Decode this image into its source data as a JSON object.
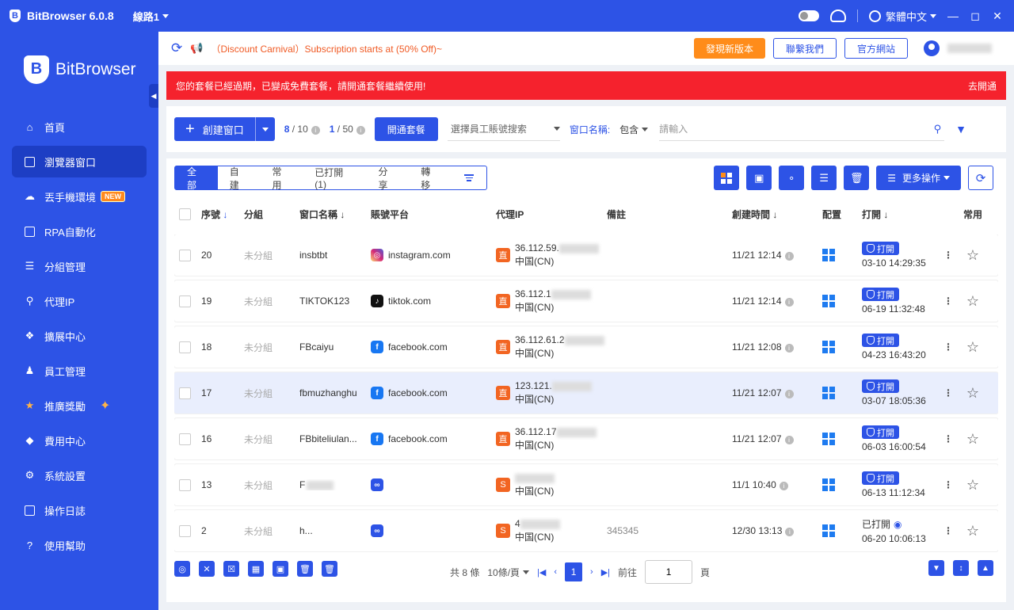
{
  "app": {
    "title": "BitBrowser 6.0.8",
    "line": "線路1",
    "language": "繁體中文"
  },
  "sidebar": {
    "brand": "BitBrowser",
    "items": [
      {
        "label": "首頁",
        "icon": "home-icon"
      },
      {
        "label": "瀏覽器窗口",
        "icon": "grid-icon",
        "active": true
      },
      {
        "label": "丟手機環境",
        "icon": "cloud-phone-icon",
        "badge": "NEW"
      },
      {
        "label": "RPA自動化",
        "icon": "rpa-icon"
      },
      {
        "label": "分組管理",
        "icon": "layers-icon"
      },
      {
        "label": "代理IP",
        "icon": "location-icon"
      },
      {
        "label": "擴展中心",
        "icon": "extension-icon"
      },
      {
        "label": "員工管理",
        "icon": "users-icon"
      },
      {
        "label": "推廣獎勵",
        "icon": "reward-icon"
      },
      {
        "label": "費用中心",
        "icon": "billing-icon"
      },
      {
        "label": "系統設置",
        "icon": "settings-icon"
      },
      {
        "label": "操作日誌",
        "icon": "log-icon"
      },
      {
        "label": "使用幫助",
        "icon": "help-icon"
      }
    ]
  },
  "promo": {
    "text": "（Discount Carnival）Subscription starts at (50% Off)~",
    "new_version": "發現新版本",
    "contact": "聯繫我們",
    "website": "官方網站"
  },
  "alert": {
    "message": "您的套餐已經過期，已變成免費套餐，請開通套餐繼續使用!",
    "action": "去開通"
  },
  "filter": {
    "create_label": "創建窗口",
    "windows_used": "8",
    "windows_total": "/ 10",
    "members_used": "1",
    "members_total": "/ 50",
    "open_plan": "開通套餐",
    "employee_placeholder": "選擇員工賬號搜索",
    "window_name_label": "窗口名稱:",
    "match_mode": "包含",
    "search_placeholder": "請輸入"
  },
  "tabs": [
    "全部",
    "自建",
    "常用",
    "已打開(1)",
    "分享",
    "轉移"
  ],
  "toolbar": {
    "more_label": "更多操作"
  },
  "columns": [
    "序號",
    "分組",
    "窗口名稱",
    "賬號平台",
    "代理IP",
    "備註",
    "創建時間",
    "配置",
    "打開",
    "常用"
  ],
  "rows": [
    {
      "no": "20",
      "group": "未分組",
      "name": "insbtbt",
      "platform": "instagram.com",
      "platform_icon": "instagram-icon",
      "ip_type": "直",
      "ip": "36.112.59.",
      "region": "中国(CN)",
      "note": "",
      "created": "11/21 12:14",
      "open_label": "打開",
      "open_time": "03-10 14:29:35"
    },
    {
      "no": "19",
      "group": "未分組",
      "name": "TIKTOK123",
      "platform": "tiktok.com",
      "platform_icon": "tiktok-icon",
      "ip_type": "直",
      "ip": "36.112.1",
      "region": "中国(CN)",
      "note": "",
      "created": "11/21 12:14",
      "open_label": "打開",
      "open_time": "06-19 11:32:48"
    },
    {
      "no": "18",
      "group": "未分組",
      "name": "FBcaiyu",
      "platform": "facebook.com",
      "platform_icon": "facebook-icon",
      "ip_type": "直",
      "ip": "36.112.61.2",
      "region": "中国(CN)",
      "note": "",
      "created": "11/21 12:08",
      "open_label": "打開",
      "open_time": "04-23 16:43:20"
    },
    {
      "no": "17",
      "group": "未分組",
      "name": "fbmuzhanghu",
      "platform": "facebook.com",
      "platform_icon": "facebook-icon",
      "ip_type": "直",
      "ip": "123.121.",
      "region": "中国(CN)",
      "note": "",
      "created": "11/21 12:07",
      "open_label": "打開",
      "open_time": "03-07 18:05:36"
    },
    {
      "no": "16",
      "group": "未分組",
      "name": "FBbiteliulan...",
      "platform": "facebook.com",
      "platform_icon": "facebook-icon",
      "ip_type": "直",
      "ip": "36.112.17",
      "region": "中国(CN)",
      "note": "",
      "created": "11/21 12:07",
      "open_label": "打開",
      "open_time": "06-03 16:00:54"
    },
    {
      "no": "13",
      "group": "未分組",
      "name": "F",
      "platform": "",
      "platform_icon": "link-icon",
      "ip_type": "S",
      "ip": "",
      "region": "中国(CN)",
      "note": "",
      "created": "11/1 10:40",
      "open_label": "打開",
      "open_time": "06-13 11:12:34"
    },
    {
      "no": "2",
      "group": "未分組",
      "name": "h...",
      "platform": "",
      "platform_icon": "link-icon",
      "ip_type": "S",
      "ip": "4",
      "region": "中国(CN)",
      "note": "345345",
      "created": "12/30 13:13",
      "open_label": "已打開",
      "open_time": "06-20 10:06:13"
    }
  ],
  "pagination": {
    "total": "共 8 條",
    "page_size": "10條/頁",
    "current": "1",
    "goto_label": "前往",
    "goto_value": "1",
    "page_suffix": "頁"
  },
  "colors": {
    "primary": "#2d53e6",
    "alert": "#f5222d",
    "orange": "#ff8c1a"
  }
}
